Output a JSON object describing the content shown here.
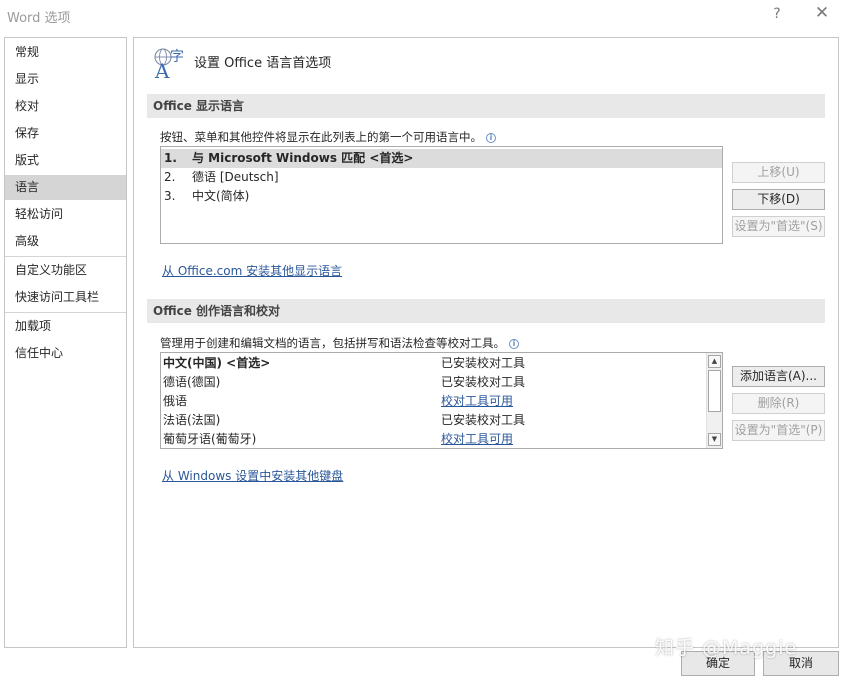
{
  "window": {
    "title": "Word 选项",
    "help": "?",
    "close": "✕"
  },
  "sidebar": {
    "items": [
      {
        "label": "常规"
      },
      {
        "label": "显示"
      },
      {
        "label": "校对"
      },
      {
        "label": "保存"
      },
      {
        "label": "版式"
      },
      {
        "label": "语言",
        "active": true
      },
      {
        "label": "轻松访问"
      },
      {
        "label": "高级"
      },
      {
        "label": "自定义功能区"
      },
      {
        "label": "快速访问工具栏"
      },
      {
        "label": "加载项"
      },
      {
        "label": "信任中心"
      }
    ]
  },
  "header": {
    "icon": "language-icon",
    "icon_text": "字",
    "icon_letter": "A",
    "title": "设置 Office 语言首选项"
  },
  "display_language": {
    "section_title": "Office 显示语言",
    "description": "按钮、菜单和其他控件将显示在此列表上的第一个可用语言中。",
    "info": "i",
    "languages": [
      {
        "num": "1.",
        "name": "与 Microsoft Windows 匹配 <首选>",
        "selected": true
      },
      {
        "num": "2.",
        "name": "德语 [Deutsch]"
      },
      {
        "num": "3.",
        "name": "中文(简体)"
      }
    ],
    "buttons": {
      "move_up": "上移(U)",
      "move_down": "下移(D)",
      "set_preferred": "设置为\"首选\"(S)"
    },
    "install_link": "从 Office.com 安装其他显示语言"
  },
  "authoring_language": {
    "section_title": "Office 创作语言和校对",
    "description": "管理用于创建和编辑文档的语言，包括拼写和语法检查等校对工具。",
    "info": "i",
    "rows": [
      {
        "language": "中文(中国) <首选>",
        "status": "已安装校对工具",
        "status_link": false,
        "selected": true
      },
      {
        "language": "德语(德国)",
        "status": "已安装校对工具",
        "status_link": false
      },
      {
        "language": "俄语",
        "status": "校对工具可用",
        "status_link": true
      },
      {
        "language": "法语(法国)",
        "status": "已安装校对工具",
        "status_link": false
      },
      {
        "language": "葡萄牙语(葡萄牙)",
        "status": "校对工具可用",
        "status_link": true
      }
    ],
    "scroll_up": "▲",
    "scroll_down": "▼",
    "buttons": {
      "add_language": "添加语言(A)...",
      "remove": "删除(R)",
      "set_preferred": "设置为\"首选\"(P)"
    },
    "keyboard_link": "从 Windows 设置中安装其他键盘"
  },
  "footer": {
    "ok": "确定",
    "cancel": "取消"
  },
  "watermark": "知乎 @Maggie",
  "colors": {
    "link": "#2b579a",
    "selected_bg": "#d5d5d5",
    "section_bg": "#e8e8e8"
  }
}
